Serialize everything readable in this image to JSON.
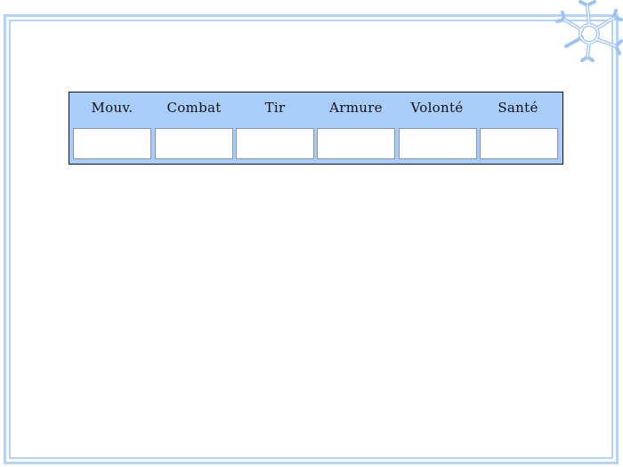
{
  "colors": {
    "frame": "#b5d3f7",
    "table_header_bg": "#a9cdfb",
    "cell_bg": "#ffffff",
    "text": "#111111"
  },
  "decoration": {
    "corner_icon": "snowflake-icon"
  },
  "stats": {
    "headers": [
      "Mouv.",
      "Combat",
      "Tir",
      "Armure",
      "Volonté",
      "Santé"
    ],
    "values": [
      "",
      "",
      "",
      "",
      "",
      ""
    ]
  }
}
